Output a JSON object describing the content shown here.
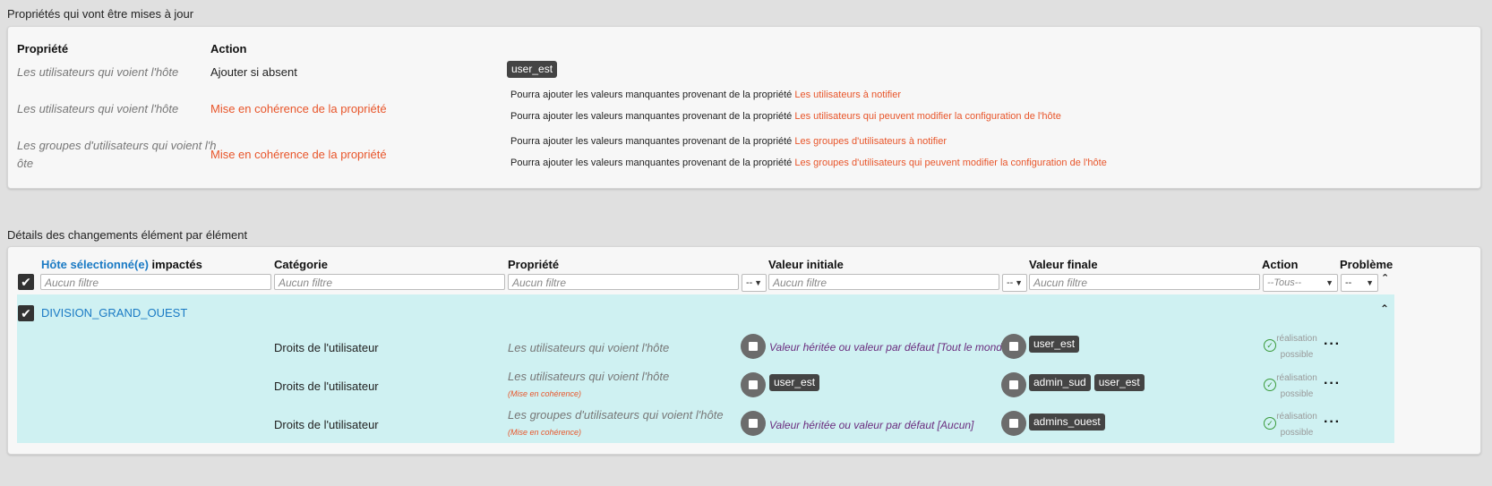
{
  "summary": {
    "title": "Propriétés qui vont être mises à jour",
    "col_property": "Propriété",
    "col_action": "Action",
    "rows": [
      {
        "property": "Les utilisateurs qui voient l'hôte",
        "action": "Ajouter si absent",
        "tag": "user_est"
      },
      {
        "property": "Les utilisateurs qui voient l'hôte",
        "action": "Mise en cohérence de la propriété",
        "lines": [
          {
            "prefix": "Pourra ajouter les valeurs manquantes provenant de la propriété",
            "link": "Les utilisateurs à notifier"
          },
          {
            "prefix": "Pourra ajouter les valeurs manquantes provenant de la propriété",
            "link": "Les utilisateurs qui peuvent modifier la configuration de l'hôte"
          }
        ]
      },
      {
        "property_line1": "Les groupes d'utilisateurs qui voient l'h",
        "property_line2": "ôte",
        "action": "Mise en cohérence de la propriété",
        "lines": [
          {
            "prefix": "Pourra ajouter les valeurs manquantes provenant de la propriété",
            "link": "Les groupes d'utilisateurs à notifier"
          },
          {
            "prefix": "Pourra ajouter les valeurs manquantes provenant de la propriété",
            "link": "Les groupes d'utilisateurs qui peuvent modifier la configuration de l'hôte"
          }
        ]
      }
    ]
  },
  "details": {
    "title": "Détails des changements élément par élément",
    "columns": {
      "host_link": "Hôte sélectionné(e)",
      "host_suffix": " impactés",
      "category": "Catégorie",
      "property": "Propriété",
      "initial": "Valeur initiale",
      "final": "Valeur finale",
      "action": "Action",
      "problem": "Problème"
    },
    "filters": {
      "placeholder": "Aucun filtre",
      "dash": "--",
      "action_all": "--Tous--"
    },
    "group": {
      "name": "DIVISION_GRAND_OUEST",
      "rows": [
        {
          "category": "Droits de l'utilisateur",
          "property": "Les utilisateurs qui voient l'hôte",
          "note": "",
          "initial_text": "Valeur héritée ou valeur par défaut [Tout le monde]",
          "initial_tags": [],
          "final_tags": [
            "user_est"
          ],
          "status_1": "réalisation",
          "status_2": "possible"
        },
        {
          "category": "Droits de l'utilisateur",
          "property": "Les utilisateurs qui voient l'hôte",
          "note": "(Mise en cohérence)",
          "initial_text": "",
          "initial_tags": [
            "user_est"
          ],
          "final_tags": [
            "admin_sud",
            "user_est"
          ],
          "status_1": "réalisation",
          "status_2": "possible"
        },
        {
          "category": "Droits de l'utilisateur",
          "property": "Les groupes d'utilisateurs qui voient l'hôte",
          "note": "(Mise en cohérence)",
          "initial_text": "Valeur héritée ou valeur par défaut [Aucun]",
          "initial_tags": [],
          "final_tags": [
            "admins_ouest"
          ],
          "status_1": "réalisation",
          "status_2": "possible"
        }
      ]
    }
  },
  "icons": {
    "checkmark": "check-icon",
    "chevron_up": "chevron-up-icon",
    "double_chevron_up": "double-chevron-up-icon",
    "more": "more-icon",
    "status_ok": "check-circle-icon"
  },
  "colors": {
    "accent_orange": "#e8552a",
    "link_blue": "#1a7ac4",
    "group_bg": "#cff1f2",
    "purple": "#6a2c7e",
    "tag_bg": "#444444"
  }
}
